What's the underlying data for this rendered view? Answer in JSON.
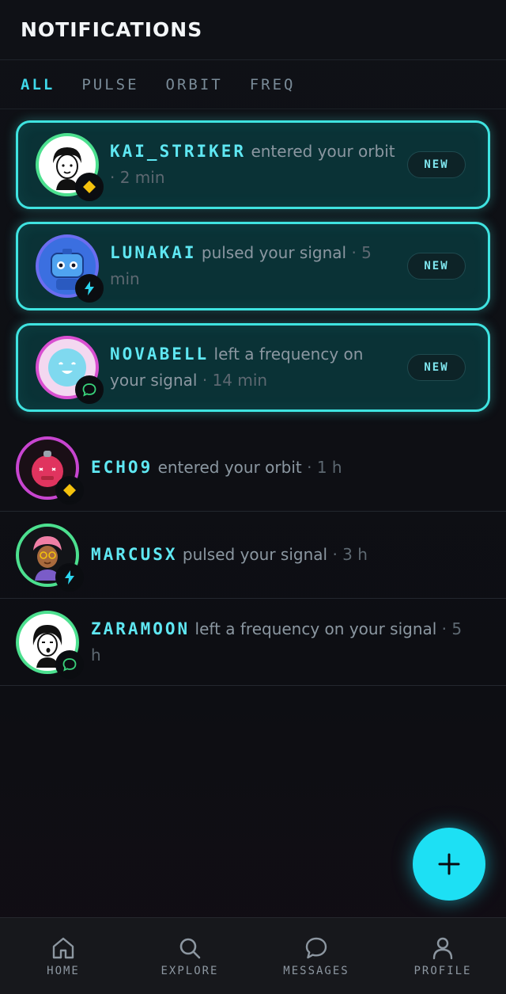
{
  "header": {
    "title": "NOTIFICATIONS"
  },
  "tabs": [
    {
      "label": "ALL",
      "active": true
    },
    {
      "label": "PULSE"
    },
    {
      "label": "ORBIT"
    },
    {
      "label": "FREQ"
    }
  ],
  "notifications": [
    {
      "user": "KAI_STRIKER",
      "action": "entered your orbit",
      "time": "2 min",
      "badge_label": "NEW",
      "badge_icon": "diamond-icon",
      "ring_color": "#4ce08f"
    },
    {
      "user": "LUNAKAI",
      "action": "pulsed your signal",
      "time": "5 min",
      "badge_label": "NEW",
      "badge_icon": "bolt-icon",
      "ring_color": "#6b6df0"
    },
    {
      "user": "NOVABELL",
      "action": "left a frequency on your signal",
      "time": "14 min",
      "badge_label": "NEW",
      "badge_icon": "chat-icon",
      "ring_color": "#d94fd1"
    },
    {
      "user": "ECHO9",
      "action": "entered your orbit",
      "time": "1 h",
      "badge_icon": "diamond-icon",
      "ring_color": "#c845d0"
    },
    {
      "user": "MARCUSX",
      "action": "pulsed your signal",
      "time": "3 h",
      "badge_icon": "bolt-icon",
      "ring_color": "#4ce08f"
    },
    {
      "user": "ZARAMOON",
      "action": "left a frequency on your signal",
      "time": "5 h",
      "badge_icon": "chat-icon",
      "ring_color": "#4ce08f"
    }
  ],
  "separator": "·",
  "fab": {
    "icon": "plus-icon",
    "color": "#1de0f4"
  },
  "nav": [
    {
      "label": "HOME",
      "icon": "home-icon"
    },
    {
      "label": "EXPLORE",
      "icon": "search-icon"
    },
    {
      "label": "MESSAGES",
      "icon": "message-icon"
    },
    {
      "label": "PROFILE",
      "icon": "user-icon"
    }
  ],
  "colors": {
    "accent": "#3fe3e0",
    "name": "#5fe7f2",
    "badge_diamond": "#f4c20d",
    "badge_bolt": "#2bd6f0",
    "badge_chat": "#39d27a"
  }
}
